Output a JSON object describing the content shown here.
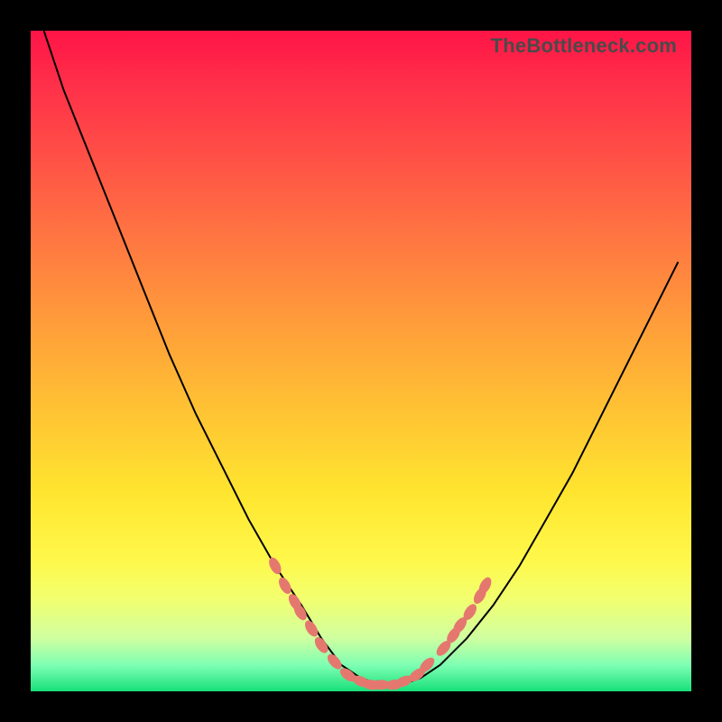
{
  "watermark": "TheBottleneck.com",
  "colors": {
    "frame": "#000000",
    "curve": "#000000",
    "marker": "#e4786f"
  },
  "chart_data": {
    "type": "line",
    "title": "",
    "xlabel": "",
    "ylabel": "",
    "xlim": [
      0,
      100
    ],
    "ylim": [
      0,
      100
    ],
    "grid": false,
    "legend": false,
    "note": "Values are read off in pixel-fraction units since the chart has no numeric axis ticks; x and y are percent of plot width/height with origin at bottom-left.",
    "series": [
      {
        "name": "bottleneck-curve",
        "x": [
          2,
          5,
          9,
          13,
          17,
          21,
          25,
          29,
          33,
          37,
          41,
          44,
          47,
          50,
          53,
          56,
          59,
          62,
          66,
          70,
          74,
          78,
          82,
          86,
          90,
          94,
          98
        ],
        "y": [
          100,
          91,
          81,
          71,
          61,
          51,
          42,
          34,
          26,
          19,
          13,
          8,
          4,
          2,
          1,
          1,
          2,
          4,
          8,
          13,
          19,
          26,
          33,
          41,
          49,
          57,
          65
        ]
      }
    ],
    "markers": {
      "name": "highlighted-segments",
      "x": [
        37.0,
        38.5,
        40.0,
        40.8,
        42.5,
        44.0,
        46.0,
        48.0,
        50.0,
        51.5,
        53.0,
        55.0,
        56.5,
        58.5,
        60.0,
        62.5,
        64.0,
        65.0,
        66.5,
        68.0,
        68.8
      ],
      "y": [
        19.0,
        16.0,
        13.5,
        12.0,
        9.5,
        7.0,
        4.5,
        2.5,
        1.5,
        1.0,
        1.0,
        1.0,
        1.5,
        2.5,
        4.0,
        6.5,
        8.5,
        10.0,
        12.0,
        14.5,
        16.0
      ]
    }
  }
}
